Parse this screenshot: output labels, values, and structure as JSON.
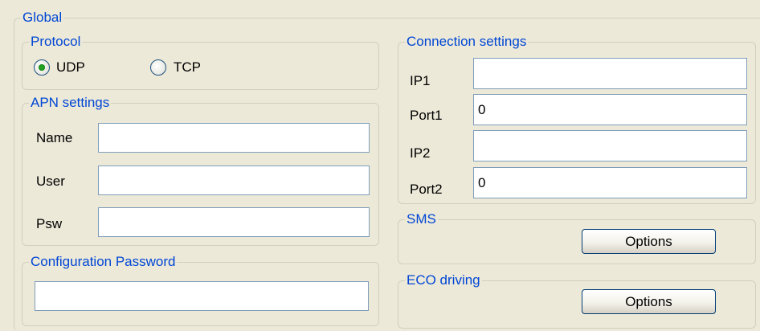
{
  "global": {
    "title": "Global"
  },
  "protocol": {
    "title": "Protocol",
    "options": [
      {
        "label": "UDP",
        "selected": true
      },
      {
        "label": "TCP",
        "selected": false
      }
    ]
  },
  "apn": {
    "title": "APN settings",
    "name_label": "Name",
    "name_value": "",
    "user_label": "User",
    "user_value": "",
    "psw_label": "Psw",
    "psw_value": ""
  },
  "config_password": {
    "title": "Configuration Password",
    "value": ""
  },
  "connection": {
    "title": "Connection settings",
    "ip1_label": "IP1",
    "ip1_value": "",
    "port1_label": "Port1",
    "port1_value": "0",
    "ip2_label": "IP2",
    "ip2_value": "",
    "port2_label": "Port2",
    "port2_value": "0"
  },
  "sms": {
    "title": "SMS",
    "options_label": "Options"
  },
  "eco": {
    "title": "ECO driving",
    "options_label": "Options"
  },
  "colors": {
    "background": "#ece9d8",
    "group_title": "#0046d5",
    "field_border": "#7f9db9"
  }
}
